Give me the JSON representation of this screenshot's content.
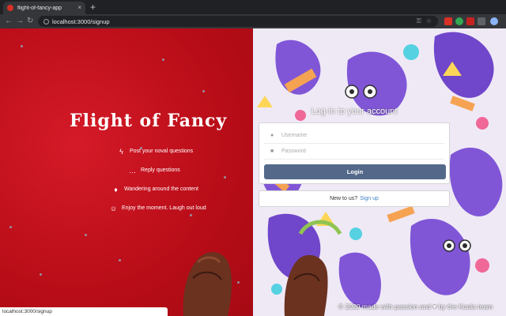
{
  "browser": {
    "tab_title": "flight-of-fancy-app",
    "tab_close": "×",
    "new_tab": "+",
    "back": "←",
    "forward": "→",
    "reload": "↻",
    "url": "localhost:3000/signup",
    "key_icon": "key-icon",
    "star_icon": "☆"
  },
  "brand": {
    "title": "Flight of Fancy"
  },
  "features": [
    {
      "icon": "lightning-icon",
      "glyph": "ϟ",
      "label": "Post your noval questions"
    },
    {
      "icon": "chat-icon",
      "glyph": "…",
      "label": "Reply questions"
    },
    {
      "icon": "balloon-icon",
      "glyph": "♦",
      "label": "Wandering around the content"
    },
    {
      "icon": "smile-icon",
      "glyph": "☺",
      "label": "Enjoy the moment. Laugh out loud"
    }
  ],
  "login": {
    "title": "Log-in to your account",
    "username_placeholder": "Username",
    "password_placeholder": "Password",
    "button": "Login"
  },
  "signup_prompt": {
    "text": "New to us?",
    "link": "Sign up"
  },
  "footer": {
    "text": "© 2020 made with passion and ♥ by the Koala team"
  },
  "status_bar": {
    "text": "localhost:3000/signup"
  },
  "colors": {
    "left_bg": "#c4101c",
    "button": "#54698a",
    "link": "#4183c4"
  }
}
